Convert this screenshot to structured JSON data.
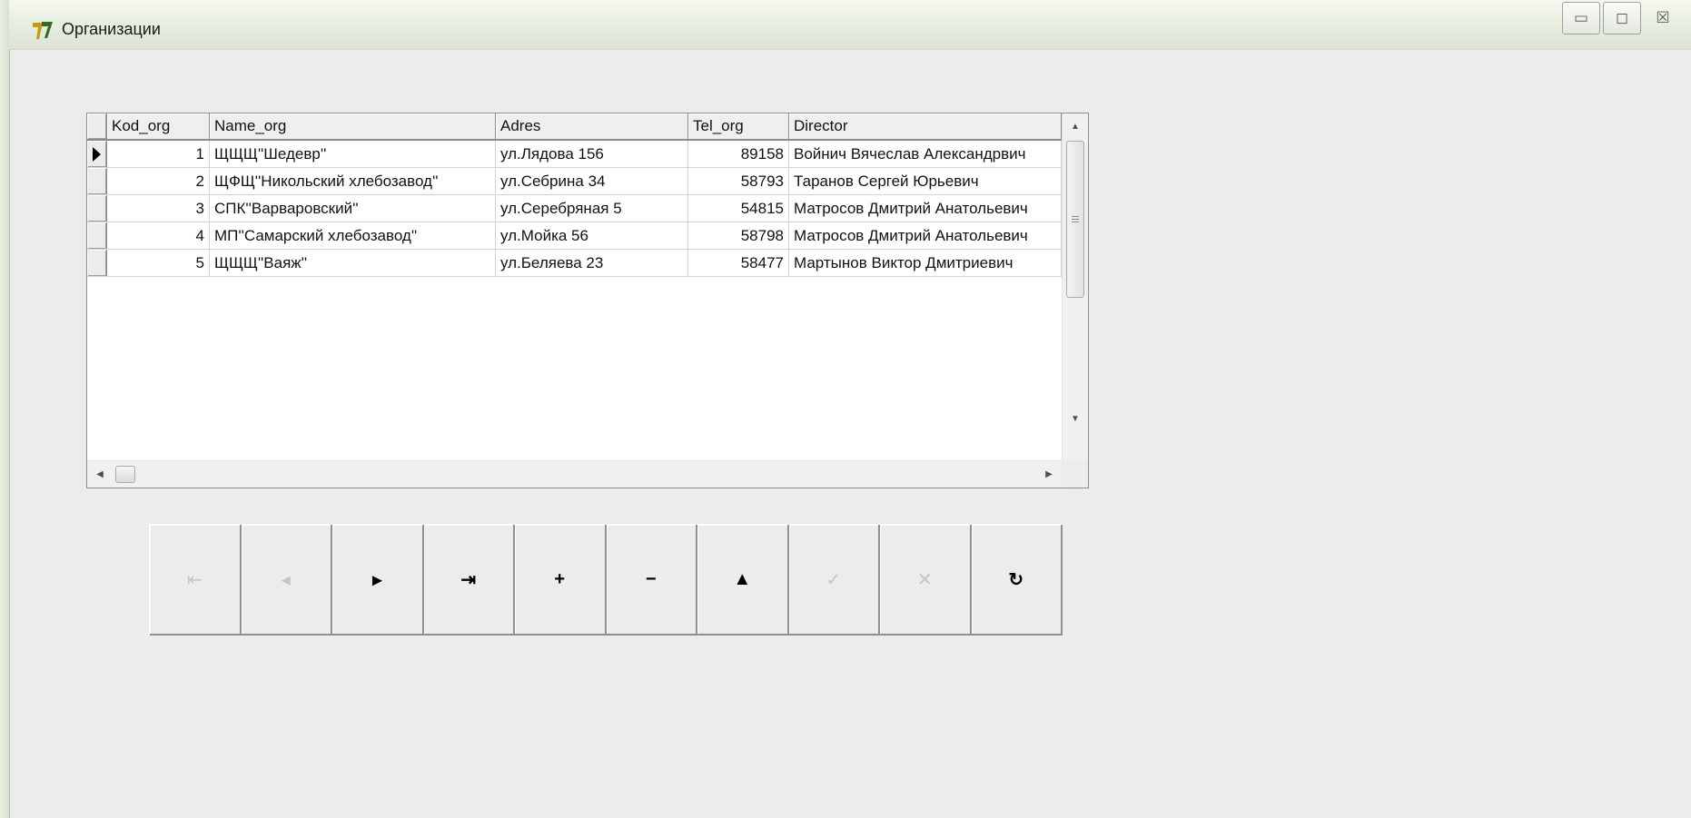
{
  "window": {
    "title": "Организации",
    "controls": {
      "minimize": "▭",
      "maximize": "◻",
      "close": "☒"
    }
  },
  "grid": {
    "columns": [
      "Kod_org",
      "Name_org",
      "Adres",
      "Tel_org",
      "Director"
    ],
    "rows": [
      {
        "kod": "1",
        "name": "ЩЩЩ''Шедевр''",
        "adres": "ул.Лядова 156",
        "tel": "89158",
        "director": "Войнич Вячеслав Александрвич",
        "current": true
      },
      {
        "kod": "2",
        "name": "ЩФЩ''Никольский хлебозавод''",
        "adres": "ул.Себрина 34",
        "tel": "58793",
        "director": "Таранов Сергей Юрьевич"
      },
      {
        "kod": "3",
        "name": "СПК''Варваровский''",
        "adres": "ул.Серебряная 5",
        "tel": "54815",
        "director": "Матросов Дмитрий Анатольевич"
      },
      {
        "kod": "4",
        "name": "МП''Самарский хлебозавод''",
        "adres": "ул.Мойка 56",
        "tel": "58798",
        "director": "Матросов Дмитрий Анатольевич"
      },
      {
        "kod": "5",
        "name": "ЩЩЩ''Ваяж''",
        "adres": "ул.Беляева 23",
        "tel": "58477",
        "director": "Мартынов Виктор Дмитриевич"
      }
    ]
  },
  "navigator": {
    "buttons": [
      {
        "name": "first-record",
        "glyph": "⇤",
        "enabled": false
      },
      {
        "name": "prior-record",
        "glyph": "◂",
        "enabled": false
      },
      {
        "name": "next-record",
        "glyph": "▸",
        "enabled": true
      },
      {
        "name": "last-record",
        "glyph": "⇥",
        "enabled": true
      },
      {
        "name": "insert-record",
        "glyph": "+",
        "enabled": true
      },
      {
        "name": "delete-record",
        "glyph": "−",
        "enabled": true
      },
      {
        "name": "edit-record",
        "glyph": "▲",
        "enabled": true
      },
      {
        "name": "post-edit",
        "glyph": "✓",
        "enabled": false
      },
      {
        "name": "cancel-edit",
        "glyph": "✕",
        "enabled": false
      },
      {
        "name": "refresh-data",
        "glyph": "↻",
        "enabled": true
      }
    ]
  }
}
